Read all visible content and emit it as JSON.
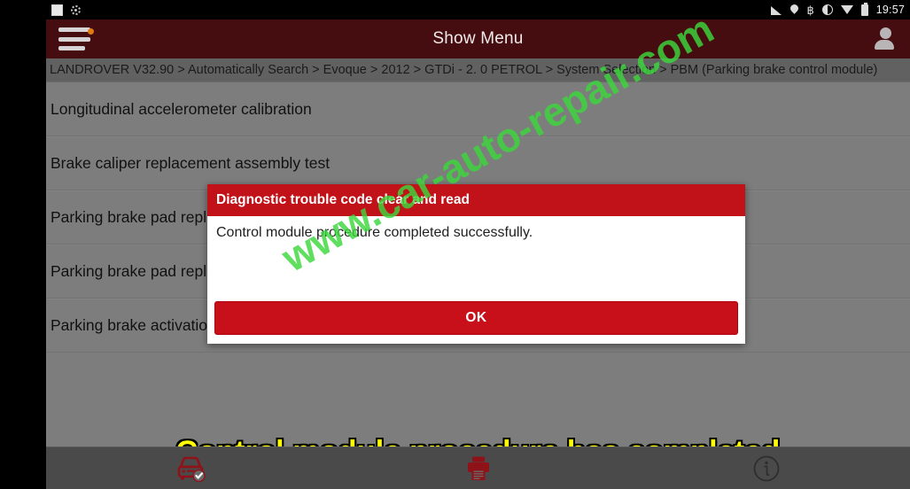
{
  "statusbar": {
    "clock": "19:57",
    "left_icons": [
      "screenshot-square-icon",
      "cast-screen-icon"
    ],
    "right_icons": [
      "signal-cast-icon",
      "location-pin-icon",
      "bluetooth-icon",
      "contrast-icon",
      "wifi-icon",
      "battery-icon"
    ],
    "bluetooth_glyph": "฿"
  },
  "titlebar": {
    "title": "Show Menu",
    "menu_icon": "hamburger-menu-icon",
    "badge_color": "#e07b12",
    "avatar_icon": "user-avatar-icon",
    "background": "#450d10"
  },
  "breadcrumb": {
    "text": "LANDROVER V32.90 > Automatically Search > Evoque > 2012 > GTDi - 2. 0 PETROL > System Selection > PBM (Parking brake control module)"
  },
  "menu": {
    "items": [
      {
        "label": "Longitudinal accelerometer calibration"
      },
      {
        "label": "Brake caliper replacement assembly test"
      },
      {
        "label": "Parking brake pad replacement"
      },
      {
        "label": "Parking brake pad replacement"
      },
      {
        "label": "Parking brake activation"
      }
    ]
  },
  "dialog": {
    "title": "Diagnostic trouble code clear and read",
    "message": "Control module procedure completed successfully.",
    "ok_label": "OK",
    "header_color": "#c1121a",
    "button_color": "#c8101a"
  },
  "caption": {
    "text": "Control module procedure has completed",
    "color": "#ffff00"
  },
  "watermark": {
    "text": "www.car-auto-repair.com",
    "color": "#3cd73c"
  },
  "toolbar": {
    "buttons": [
      {
        "name": "vehicle-check-icon",
        "label": ""
      },
      {
        "name": "printer-icon",
        "label": ""
      },
      {
        "name": "info-icon",
        "label": ""
      }
    ]
  }
}
